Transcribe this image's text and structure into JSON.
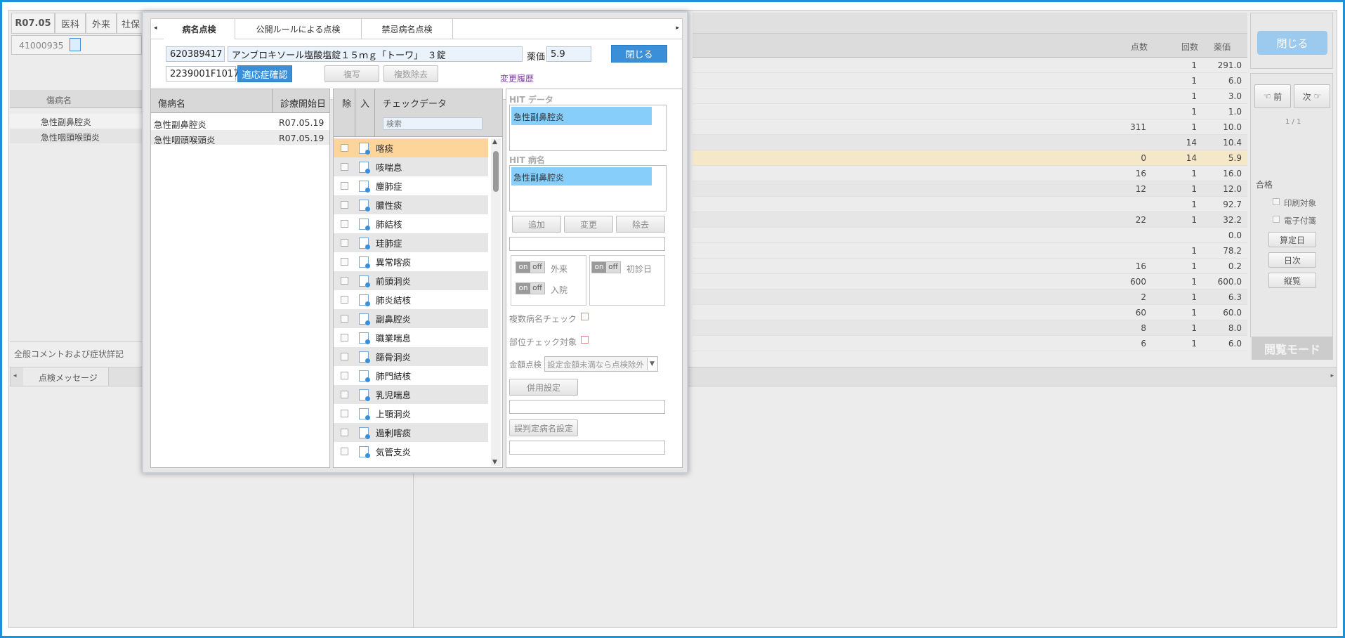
{
  "top": {
    "date": "R07.05",
    "dept": "医科",
    "visit": "外来",
    "insurance": "社保",
    "patient_id": "41000935"
  },
  "left": {
    "col_header": "傷病名",
    "diseases": [
      "急性副鼻腔炎",
      "急性咽頭喉頭炎"
    ],
    "comment_label": "全般コメントおよび症状詳記",
    "msg_tab": "点検メッセージ"
  },
  "grid": {
    "headers": {
      "points": "点数",
      "times": "回数",
      "price": "薬価"
    },
    "rows": [
      {
        "points": "",
        "times": "1",
        "price": "291.0"
      },
      {
        "points": "",
        "times": "1",
        "price": "6.0"
      },
      {
        "points": "",
        "times": "1",
        "price": "3.0"
      },
      {
        "points": "",
        "times": "1",
        "price": "1.0"
      },
      {
        "points": "311",
        "times": "1",
        "price": "10.0"
      },
      {
        "points": "",
        "times": "14",
        "price": "10.4"
      },
      {
        "points": "0",
        "times": "14",
        "price": "5.9"
      },
      {
        "points": "16",
        "times": "1",
        "price": "16.0"
      },
      {
        "points": "12",
        "times": "1",
        "price": "12.0"
      },
      {
        "points": "",
        "times": "1",
        "price": "92.7"
      },
      {
        "points": "22",
        "times": "1",
        "price": "32.2"
      },
      {
        "points": "",
        "times": "",
        "price": "0.0"
      },
      {
        "points": "",
        "times": "1",
        "price": "78.2"
      },
      {
        "points": "16",
        "times": "1",
        "price": "0.2"
      },
      {
        "points": "600",
        "times": "1",
        "price": "600.0"
      },
      {
        "points": "2",
        "times": "1",
        "price": "6.3"
      },
      {
        "points": "60",
        "times": "1",
        "price": "60.0"
      },
      {
        "points": "8",
        "times": "1",
        "price": "8.0"
      },
      {
        "points": "6",
        "times": "1",
        "price": "6.0"
      }
    ]
  },
  "right": {
    "close": "閉じる",
    "prev": "前",
    "next": "次",
    "page": "1 / 1",
    "status": "合格",
    "print_target": "印刷対象",
    "e_attach": "電子付箋",
    "calc_day": "算定日",
    "daily": "日次",
    "vertical": "縦覧",
    "view_mode": "閲覧モード"
  },
  "dialog": {
    "tabs": [
      "病名点検",
      "公開ルールによる点検",
      "禁忌病名点検"
    ],
    "code": "620389417",
    "drug_name": "アンブロキソール塩酸塩錠１５ｍｇ「トーワ」　３錠",
    "price_label": "薬価",
    "price": "5.9",
    "close": "閉じる",
    "code2": "2239001F1017",
    "indication": "適応症確認",
    "copy": "複写",
    "multi_remove": "複数除去",
    "history": "変更履歴",
    "disease_hdr": {
      "name": "傷病名",
      "start": "診療開始日"
    },
    "diseases": [
      {
        "name": "急性副鼻腔炎",
        "start": "R07.05.19"
      },
      {
        "name": "急性咽頭喉頭炎",
        "start": "R07.05.19"
      }
    ],
    "check_hdr": {
      "ex": "除",
      "in": "入",
      "data": "チェックデータ"
    },
    "search_placeholder": "検索",
    "checks": [
      "喀痰",
      "咳喘息",
      "塵肺症",
      "膿性痰",
      "肺結核",
      "珪肺症",
      "異常喀痰",
      "前頭洞炎",
      "肺炎結核",
      "副鼻腔炎",
      "職業喘息",
      "篩骨洞炎",
      "肺門結核",
      "乳児喘息",
      "上顎洞炎",
      "過剰喀痰",
      "気管支炎"
    ],
    "hit_data_label": "HIT データ",
    "hit_data": "急性副鼻腔炎",
    "hit_name_label": "HIT 病名",
    "hit_name": "急性副鼻腔炎",
    "add": "追加",
    "change": "変更",
    "remove": "除去",
    "on": "on",
    "off": "off",
    "outpatient": "外来",
    "first_visit": "初診日",
    "inpatient": "入院",
    "multi_check": "複数病名チェック",
    "part_check": "部位チェック対象",
    "amount_label": "金額点検",
    "amount_value": "設定金額未満なら点検除外",
    "combo": "併用設定",
    "misjudge": "誤判定病名設定"
  }
}
